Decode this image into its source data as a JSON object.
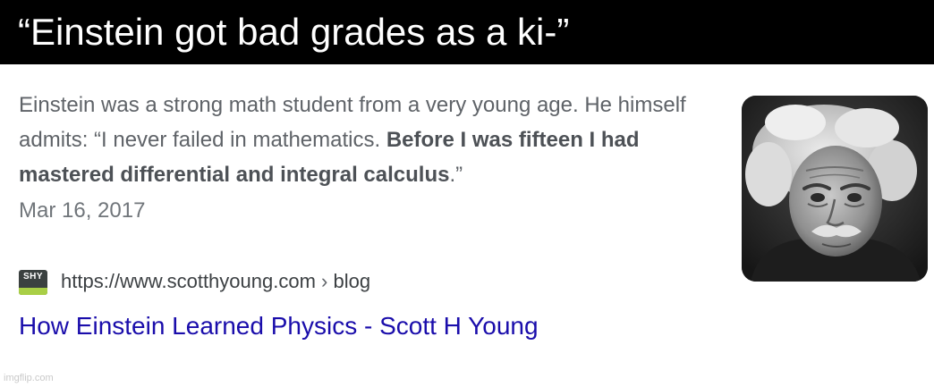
{
  "caption": {
    "text": "“Einstein got bad grades as a ki-”"
  },
  "search_result": {
    "snippet": {
      "part1": "Einstein was a strong math student from a very young age. He himself admits: “I never failed in mathematics. ",
      "bold": "Before I was fifteen I had mastered differential and integral calculus",
      "part2": ".”"
    },
    "date": "Mar 16, 2017",
    "site_icon_text": "SHY",
    "url": "https://www.scotthyoung.com",
    "url_separator": "›",
    "url_path": "blog",
    "title": "How Einstein Learned Physics - Scott H Young",
    "thumbnail_subject": "einstein-portrait"
  },
  "watermark": "imgflip.com",
  "colors": {
    "caption_bg": "#000000",
    "caption_text": "#ffffff",
    "snippet_text": "#5f6368",
    "link": "#1a0dab",
    "favicon_bg": "#3b4140",
    "favicon_accent": "#a9cf46"
  }
}
